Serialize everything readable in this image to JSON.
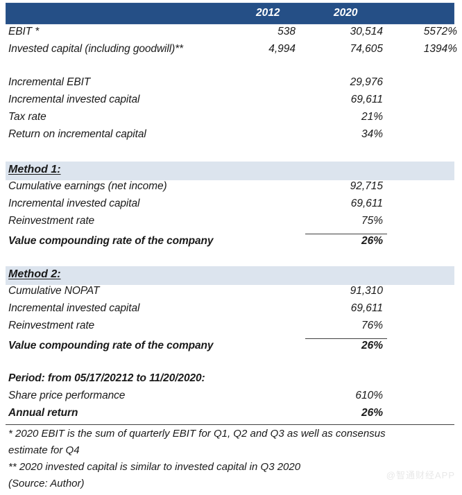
{
  "table": {
    "columns": [
      "",
      "2012",
      "2020",
      ""
    ],
    "header": {
      "col1": "2012",
      "col2": "2020"
    },
    "top_rows": [
      {
        "label": "EBIT *",
        "c1": "538",
        "c2": "30,514",
        "c3": "5572%"
      },
      {
        "label": "Invested capital (including goodwill)**",
        "c1": "4,994",
        "c2": "74,605",
        "c3": "1394%"
      }
    ],
    "incremental_rows": [
      {
        "label": "Incremental EBIT",
        "c1": "",
        "c2": "29,976",
        "c3": ""
      },
      {
        "label": "Incremental invested capital",
        "c1": "",
        "c2": "69,611",
        "c3": ""
      },
      {
        "label": "Tax rate",
        "c1": "",
        "c2": "21%",
        "c3": ""
      },
      {
        "label": "Return on incremental capital",
        "c1": "",
        "c2": "34%",
        "c3": ""
      }
    ],
    "method1": {
      "title": "Method 1:",
      "rows": [
        {
          "label": "Cumulative earnings (net income)",
          "c1": "",
          "c2": "92,715",
          "c3": ""
        },
        {
          "label": "Incremental invested capital",
          "c1": "",
          "c2": "69,611",
          "c3": ""
        },
        {
          "label": "Reinvestment rate",
          "c1": "",
          "c2": "75%",
          "c3": ""
        }
      ],
      "total": {
        "label": "Value compounding rate of the company",
        "c1": "",
        "c2": "26%",
        "c3": ""
      }
    },
    "method2": {
      "title": "Method 2:",
      "rows": [
        {
          "label": "Cumulative NOPAT",
          "c1": "",
          "c2": "91,310",
          "c3": ""
        },
        {
          "label": "Incremental invested capital",
          "c1": "",
          "c2": "69,611",
          "c3": ""
        },
        {
          "label": "Reinvestment rate",
          "c1": "",
          "c2": "76%",
          "c3": ""
        }
      ],
      "total": {
        "label": "Value compounding rate of the company",
        "c1": "",
        "c2": "26%",
        "c3": ""
      }
    },
    "period": {
      "title": "Period: from 05/17/20212 to 11/20/2020:",
      "rows": [
        {
          "label": "Share price performance",
          "c1": "",
          "c2": "610%",
          "c3": ""
        }
      ],
      "total": {
        "label": "Annual return",
        "c1": "",
        "c2": "26%",
        "c3": ""
      }
    },
    "footnotes": [
      "* 2020 EBIT is the sum of quarterly EBIT for Q1, Q2 and Q3 as well as consensus",
      "estimate for Q4",
      "** 2020 invested capital is similar to invested capital in Q3 2020",
      "(Source: Author)"
    ],
    "watermark": "@智通财经APP"
  },
  "colors": {
    "header_bar": "#254f86",
    "section_band": "#dce4ee",
    "rule": "#3f3f3f",
    "text": "#1a1a1a"
  }
}
